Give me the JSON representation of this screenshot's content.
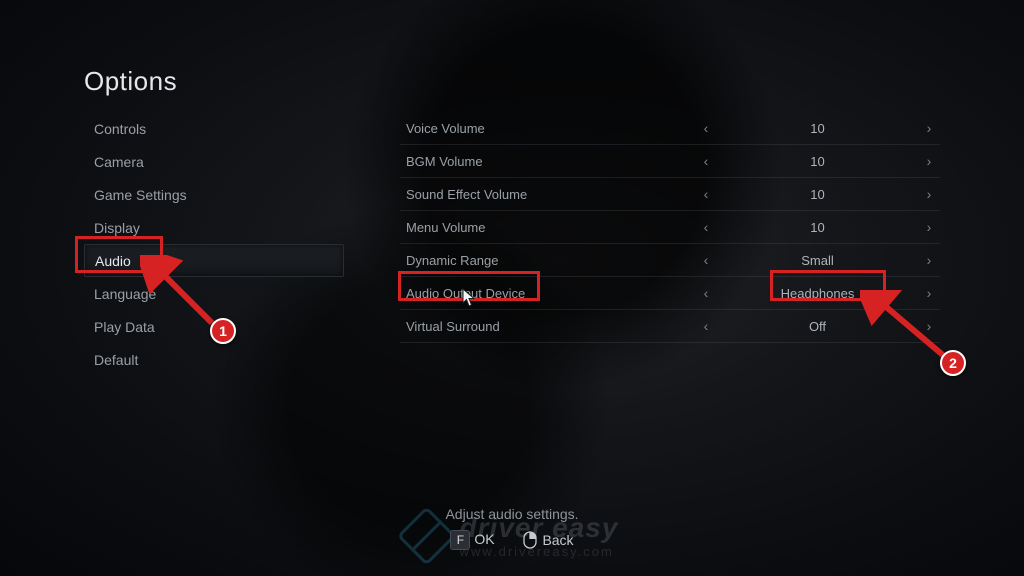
{
  "title": "Options",
  "sidebar": {
    "items": [
      {
        "label": "Controls",
        "active": false
      },
      {
        "label": "Camera",
        "active": false
      },
      {
        "label": "Game Settings",
        "active": false
      },
      {
        "label": "Display",
        "active": false
      },
      {
        "label": "Audio",
        "active": true
      },
      {
        "label": "Language",
        "active": false
      },
      {
        "label": "Play Data",
        "active": false
      },
      {
        "label": "Default",
        "active": false
      }
    ]
  },
  "settings": [
    {
      "label": "Voice Volume",
      "value": "10"
    },
    {
      "label": "BGM Volume",
      "value": "10"
    },
    {
      "label": "Sound Effect Volume",
      "value": "10"
    },
    {
      "label": "Menu Volume",
      "value": "10"
    },
    {
      "label": "Dynamic Range",
      "value": "Small"
    },
    {
      "label": "Audio Output Device",
      "value": "Headphones"
    },
    {
      "label": "Virtual Surround",
      "value": "Off"
    }
  ],
  "footer": {
    "hint": "Adjust audio settings.",
    "ok_key": "F",
    "ok_label": "OK",
    "back_label": "Back"
  },
  "annotations": {
    "callout1": "1",
    "callout2": "2"
  },
  "watermark": {
    "brand": "driver easy",
    "url": "www.drivereasy.com"
  }
}
